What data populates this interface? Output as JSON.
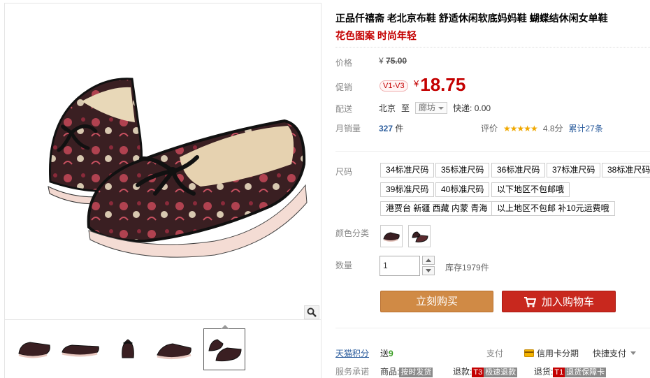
{
  "product": {
    "title": "正品仟禧斋 老北京布鞋 舒适休闲软底妈妈鞋 蝴蝶结休闲女单鞋",
    "subtitle": "花色图案 时尚年轻"
  },
  "price": {
    "label": "价格",
    "currency": "¥",
    "original": "75.00"
  },
  "promo": {
    "label": "促销",
    "badge": "V1-V3",
    "currency": "¥",
    "price": "18.75"
  },
  "shipping": {
    "label": "配送",
    "from": "北京",
    "to_word": "至",
    "to_city": "廊坊",
    "fee": "快递: 0.00"
  },
  "sales": {
    "label": "月销量",
    "count": "327",
    "unit": "件"
  },
  "rating": {
    "label": "评价",
    "stars": "★★★★★",
    "score": "4.8分",
    "total": "累计27条"
  },
  "size": {
    "label": "尺码",
    "options": [
      "34标准尺码",
      "35标准尺码",
      "36标准尺码",
      "37标准尺码",
      "38标准尺码",
      "39标准尺码",
      "40标准尺码",
      "以下地区不包邮哦",
      "港贾台 新疆 西藏 内蒙 青海",
      "以上地区不包邮 补10元运费哦"
    ]
  },
  "color": {
    "label": "颜色分类"
  },
  "quantity": {
    "label": "数量",
    "value": "1",
    "stock": "库存1979件"
  },
  "buttons": {
    "buy_now": "立刻购买",
    "add_cart": "加入购物车"
  },
  "points": {
    "label": "天猫积分",
    "prefix": "送",
    "value": "9"
  },
  "payment": {
    "label": "支付",
    "credit": "信用卡分期",
    "quick": "快捷支付"
  },
  "promise": {
    "label": "服务承诺",
    "goods_label": "商品:",
    "goods_tag": "按时发货",
    "refund_label": "退款:",
    "refund_code": "T3",
    "refund_tag": "极速退款",
    "return_label": "退货:",
    "return_code": "T1",
    "return_tag": "退货保障卡"
  },
  "colors": {
    "price_red": "#c40000",
    "buy_button": "#d08a45",
    "cart_button": "#c8281e",
    "link_blue": "#2d5e9e",
    "star_gold": "#f0a800"
  }
}
